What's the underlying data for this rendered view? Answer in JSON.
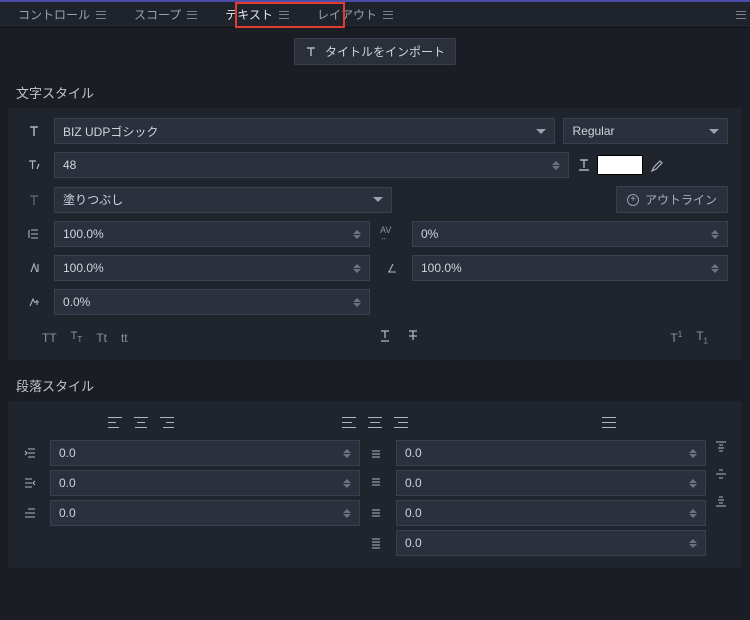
{
  "tabs": {
    "control": "コントロール",
    "scope": "スコープ",
    "text": "テキスト",
    "layout": "レイアウト",
    "active": "text"
  },
  "import_btn": "タイトルをインポート",
  "char_style": {
    "heading": "文字スタイル",
    "font_family": "BIZ UDPゴシック",
    "font_weight": "Regular",
    "font_size": "48",
    "fill_mode": "塗りつぶし",
    "outline_btn": "アウトライン",
    "line_spacing": "100.0%",
    "height": "100.0%",
    "baseline": "0.0%",
    "tracking": "0%",
    "slant": "100.0%",
    "color": "#ffffff"
  },
  "para_style": {
    "heading": "段落スタイル",
    "left_indent": "0.0",
    "right_indent": "0.0",
    "first_line": "0.0",
    "space_before": "0.0",
    "space_after": "0.0",
    "v3": "0.0",
    "v4": "0.0"
  }
}
